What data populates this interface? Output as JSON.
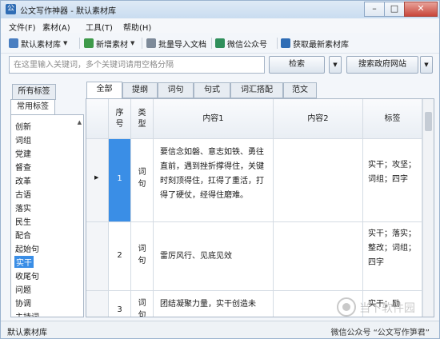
{
  "window": {
    "app_name": "公文写作神器",
    "separator": "-",
    "doc_name": "默认素材库",
    "min_glyph": "–",
    "max_glyph": "□",
    "close_glyph": "✕"
  },
  "menu": {
    "items": [
      "文件(F)",
      "素材(A)",
      "工具(T)",
      "帮助(H)"
    ]
  },
  "toolbar": {
    "library_label": "默认素材库",
    "new_label": "新增素材",
    "import_label": "批量导入文档",
    "wechat_label": "微信公众号",
    "fetch_label": "获取最新素材库"
  },
  "search": {
    "placeholder": "在这里输入关键词，多个关键词请用空格分隔",
    "search_button": "检索",
    "gov_button": "搜索政府网站"
  },
  "left_panel": {
    "tabs": [
      "所有标签",
      "常用标签"
    ],
    "items": [
      "创新",
      "词组",
      "党建",
      "督查",
      "改革",
      "古语",
      "落实",
      "民生",
      "配合",
      "起始句",
      "实干",
      "收尾句",
      "问题",
      "协调",
      "主持词"
    ],
    "selected": "实干"
  },
  "content_tabs": [
    "全部",
    "提纲",
    "词句",
    "句式",
    "词汇搭配",
    "范文"
  ],
  "grid": {
    "headers": {
      "seq": "序号",
      "type": "类型",
      "content1": "内容1",
      "content2": "内容2",
      "tags": "标签"
    },
    "rows": [
      {
        "seq": "1",
        "type": "词句",
        "content1": "要信念如磐、意志如铁、勇往直前，遇到挫折撑得住，关键时刻顶得住，扛得了重活，打得了硬仗，经得住磨难。",
        "content2": "",
        "tags": "实干；攻坚；词组；四字"
      },
      {
        "seq": "2",
        "type": "词句",
        "content1": "雷厉风行、见底见效",
        "content2": "",
        "tags": "实干；落实；整改；词组；四字"
      },
      {
        "seq": "3",
        "type": "词句",
        "content1": "团结凝聚力量，实干创造未",
        "content2": "",
        "tags": "实干；励"
      }
    ]
  },
  "status": {
    "left": "默认素材库",
    "right": "微信公众号 “公文写作笋君”"
  },
  "watermark": {
    "text": "当下软件园"
  },
  "colors": {
    "accent": "#3a8ee6",
    "title_bar": "#c9dcf0",
    "close_button": "#c8463a"
  }
}
